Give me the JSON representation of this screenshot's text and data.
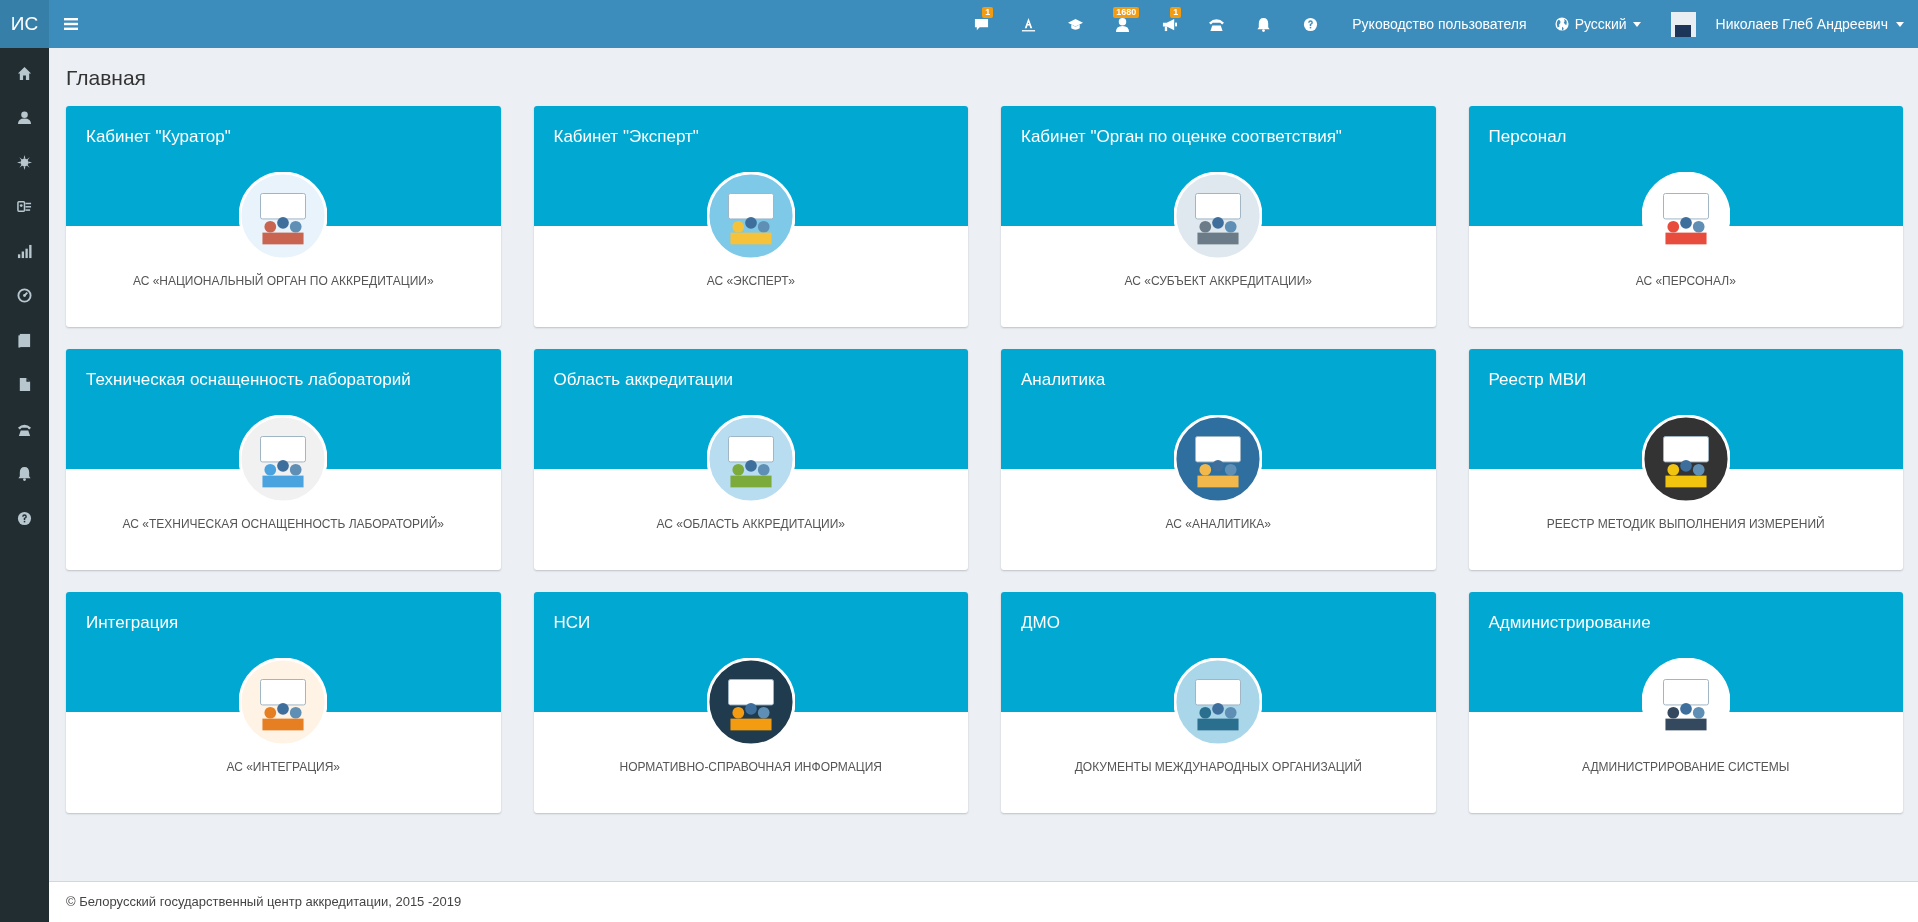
{
  "logo": "ИС",
  "topbar": {
    "messages_badge": "1",
    "profile_badge": "1680",
    "announcements_badge": "1",
    "manual_link": "Руководство пользователя",
    "language": "Русский",
    "user": "Николаев Глеб Андреевич"
  },
  "page_title": "Главная",
  "cards": [
    {
      "title": "Кабинет \"Куратор\"",
      "subtitle": "АС «НАЦИОНАЛЬНЫЙ ОРГАН ПО АККРЕДИТАЦИИ»"
    },
    {
      "title": "Кабинет \"Эксперт\"",
      "subtitle": "АС «ЭКСПЕРТ»"
    },
    {
      "title": "Кабинет \"Орган по оценке соответствия\"",
      "subtitle": "АС «СУБЪЕКТ АККРЕДИТАЦИИ»"
    },
    {
      "title": "Персонал",
      "subtitle": "АС «ПЕРСОНАЛ»"
    },
    {
      "title": "Техническая оснащенность лабораторий",
      "subtitle": "АС «ТЕХНИЧЕСКАЯ ОСНАЩЕННОСТЬ ЛАБОРАТОРИЙ»"
    },
    {
      "title": "Область аккредитации",
      "subtitle": "АС «ОБЛАСТЬ АККРЕДИТАЦИИ»"
    },
    {
      "title": "Аналитика",
      "subtitle": "АС «АНАЛИТИКА»"
    },
    {
      "title": "Реестр МВИ",
      "subtitle": "РЕЕСТР МЕТОДИК ВЫПОЛНЕНИЯ ИЗМЕРЕНИЙ"
    },
    {
      "title": "Интеграция",
      "subtitle": "АС «ИНТЕГРАЦИЯ»"
    },
    {
      "title": "НСИ",
      "subtitle": "НОРМАТИВНО-СПРАВОЧНАЯ ИНФОРМАЦИЯ"
    },
    {
      "title": "ДМО",
      "subtitle": "ДОКУМЕНТЫ МЕЖДУНАРОДНЫХ ОРГАНИЗАЦИЙ"
    },
    {
      "title": "Администрирование",
      "subtitle": "АДМИНИСТРИРОВАНИЕ СИСТЕМЫ"
    }
  ],
  "footer": "© Белорусский государственный центр аккредитации, 2015 -2019"
}
